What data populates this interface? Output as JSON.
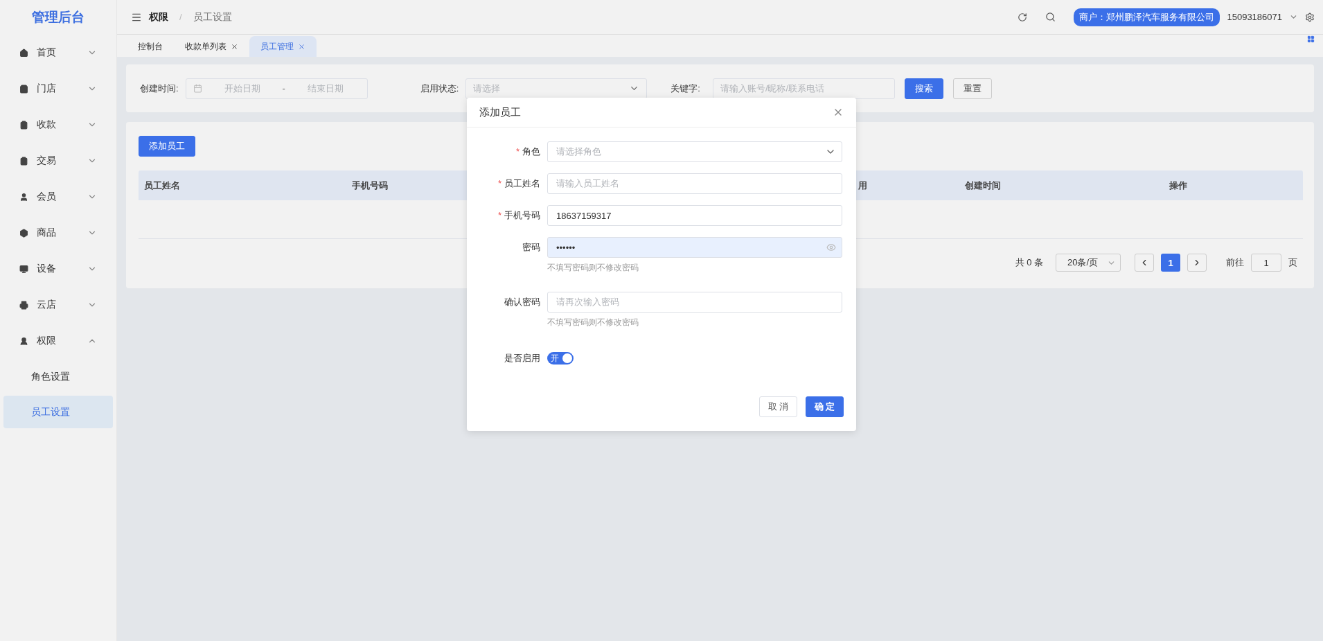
{
  "sidebar": {
    "logo": "管理后台",
    "items": [
      {
        "label": "首页",
        "expanded": false
      },
      {
        "label": "门店",
        "expanded": false
      },
      {
        "label": "收款",
        "expanded": false
      },
      {
        "label": "交易",
        "expanded": false
      },
      {
        "label": "会员",
        "expanded": false
      },
      {
        "label": "商品",
        "expanded": false
      },
      {
        "label": "设备",
        "expanded": false
      },
      {
        "label": "云店",
        "expanded": false
      },
      {
        "label": "权限",
        "expanded": true,
        "children": [
          {
            "label": "角色设置",
            "selected": false
          },
          {
            "label": "员工设置",
            "selected": true
          }
        ]
      }
    ]
  },
  "header": {
    "breadcrumb": [
      "权限",
      "员工设置"
    ],
    "breadcrumb_separator": "/",
    "merchant": "商户：郑州鹏泽汽车服务有限公司",
    "user": "15093186071"
  },
  "tabs": [
    {
      "label": "控制台",
      "selected": false,
      "closable": false
    },
    {
      "label": "收款单列表",
      "selected": false,
      "closable": true
    },
    {
      "label": "员工管理",
      "selected": true,
      "closable": true
    }
  ],
  "filters": {
    "created_label": "创建时间:",
    "start_placeholder": "开始日期",
    "range_separator": "-",
    "end_placeholder": "结束日期",
    "status_label": "启用状态:",
    "status_placeholder": "请选择",
    "keyword_label": "关键字:",
    "keyword_placeholder": "请输入账号/昵称/联系电话",
    "search_button": "搜索",
    "reset_button": "重置"
  },
  "table": {
    "add_button": "添加员工",
    "columns": [
      "员工姓名",
      "手机号码",
      "用",
      "创建时间",
      "操作"
    ]
  },
  "pagination": {
    "total": "共 0 条",
    "page_size": "20条/页",
    "pages": [
      {
        "label": "1",
        "selected": true
      }
    ],
    "goto_label": "前往",
    "goto_value": "1",
    "goto_suffix": "页"
  },
  "dialog": {
    "title": "添加员工",
    "required_mark": "*",
    "fields": [
      {
        "kind": "select",
        "label": "角色",
        "required": true,
        "placeholder": "请选择角色"
      },
      {
        "kind": "text",
        "label": "员工姓名",
        "required": true,
        "placeholder": "请输入员工姓名"
      },
      {
        "kind": "text",
        "label": "手机号码",
        "required": true,
        "value": "18637159317"
      },
      {
        "kind": "password",
        "label": "密码",
        "required": false,
        "value": "••••••",
        "autofilled": true,
        "hint": "不填写密码则不修改密码"
      },
      {
        "kind": "text",
        "label": "确认密码",
        "required": false,
        "placeholder": "请再次输入密码",
        "hint": "不填写密码则不修改密码"
      },
      {
        "kind": "switch",
        "label": "是否启用",
        "required": false,
        "on": true,
        "switch_text": "开"
      }
    ],
    "buttons": [
      {
        "label": "取 消",
        "kind": "default"
      },
      {
        "label": "确 定",
        "kind": "primary"
      }
    ]
  }
}
